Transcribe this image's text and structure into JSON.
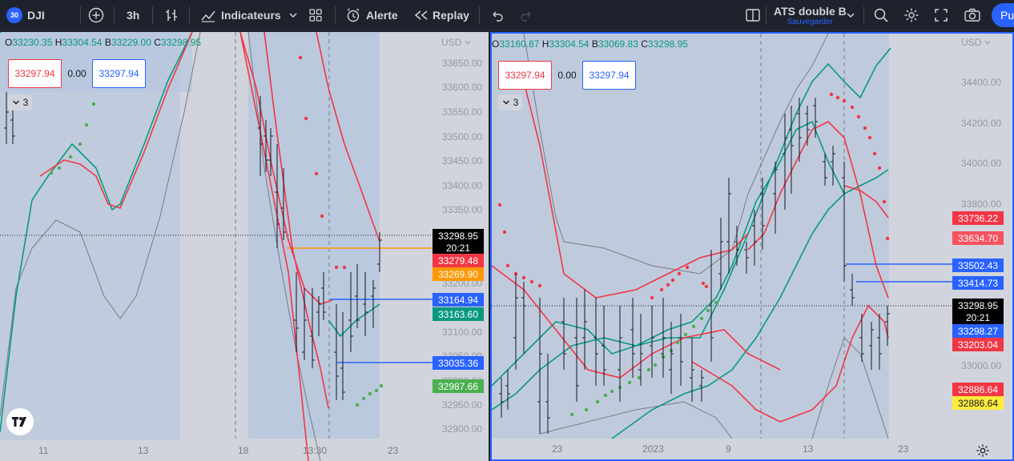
{
  "toolbar": {
    "symbol_badge": "30",
    "symbol": "DJI",
    "interval": "3h",
    "indicators_label": "Indicateurs",
    "alert_label": "Alerte",
    "replay_label": "Replay",
    "layout_name": "ATS double B",
    "layout_sub": "Sauvegarder",
    "publish_label": "Pu"
  },
  "left_chart": {
    "ohlc": {
      "o_label": "O",
      "o": "33230.35",
      "h_label": "H",
      "h": "33304.54",
      "l_label": "B",
      "l": "33229.00",
      "c_label": "C",
      "c": "33298.95"
    },
    "sell_price": "33297.94",
    "spread": "0.00",
    "buy_price": "33297.94",
    "indicator_count": "3",
    "currency": "USD",
    "price_axis": [
      "33650.00",
      "33600.00",
      "33550.00",
      "33500.00",
      "33450.00",
      "33400.00",
      "33350.00",
      "33200.00",
      "33100.00",
      "33050.00",
      "33000.00",
      "32950.00",
      "32900.00"
    ],
    "time_axis": [
      "11",
      "13",
      "18",
      "13:30",
      "23"
    ],
    "tags": [
      {
        "label": "33298.95",
        "sub": "20:21",
        "color": "#000000"
      },
      {
        "label": "33279.48",
        "color": "#f23645"
      },
      {
        "label": "33269.90",
        "color": "#ff9800"
      },
      {
        "label": "33164.94",
        "color": "#2962ff"
      },
      {
        "label": "33163.60",
        "color": "#089981"
      },
      {
        "label": "33035.36",
        "color": "#2962ff"
      },
      {
        "label": "32987.66",
        "color": "#4caf50"
      }
    ]
  },
  "right_chart": {
    "ohlc": {
      "o_label": "O",
      "o": "33160.87",
      "h_label": "H",
      "h": "33304.54",
      "l_label": "B",
      "l": "33069.83",
      "c_label": "C",
      "c": "33298.95"
    },
    "sell_price": "33297.94",
    "spread": "0.00",
    "buy_price": "33297.94",
    "indicator_count": "3",
    "currency": "USD",
    "price_axis": [
      "34400.00",
      "34200.00",
      "34000.00",
      "33800.00",
      "33000.00"
    ],
    "time_axis": [
      "23",
      "2023",
      "9",
      "13",
      "23"
    ],
    "tags": [
      {
        "label": "33736.22",
        "color": "#f23645"
      },
      {
        "label": "33634.70",
        "color": "#f7525f"
      },
      {
        "label": "33502.43",
        "color": "#2962ff"
      },
      {
        "label": "33414.73",
        "color": "#2962ff"
      },
      {
        "label": "33298.95",
        "sub": "20:21",
        "color": "#000000"
      },
      {
        "label": "33298.27",
        "color": "#2962ff"
      },
      {
        "label": "33203.04",
        "color": "#f23645"
      },
      {
        "label": "32886.64",
        "color": "#f23645"
      },
      {
        "label": "32886.64",
        "color": "#ffeb3b"
      }
    ]
  }
}
